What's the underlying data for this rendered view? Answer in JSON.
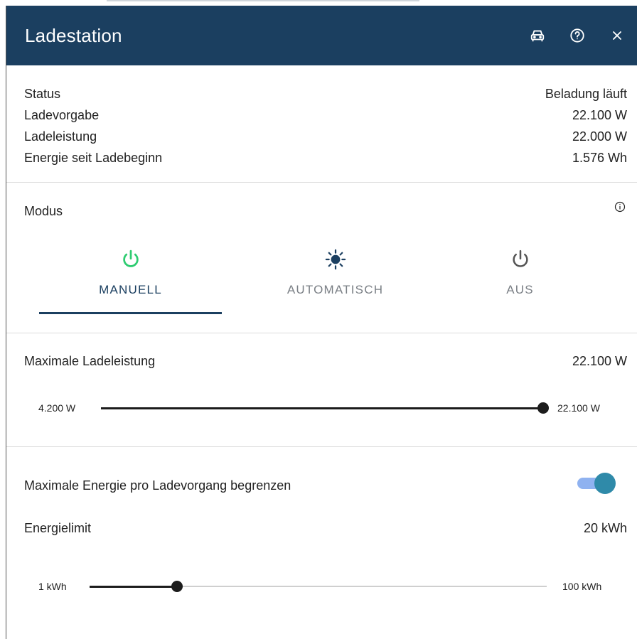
{
  "header": {
    "title": "Ladestation"
  },
  "icons": {
    "car": "car-icon",
    "help": "help-circle-icon",
    "close": "close-icon",
    "info": "info-icon"
  },
  "status": [
    {
      "label": "Status",
      "value": "Beladung läuft"
    },
    {
      "label": "Ladevorgabe",
      "value": "22.100 W"
    },
    {
      "label": "Ladeleistung",
      "value": "22.000 W"
    },
    {
      "label": "Energie seit Ladebeginn",
      "value": "1.576 Wh"
    }
  ],
  "modus": {
    "label": "Modus",
    "tabs": [
      {
        "label": "MANUELL",
        "icon": "power-icon",
        "active": true
      },
      {
        "label": "AUTOMATISCH",
        "icon": "sun-icon",
        "active": false
      },
      {
        "label": "AUS",
        "icon": "power-icon",
        "active": false
      }
    ]
  },
  "max_ladeleistung": {
    "label": "Maximale Ladeleistung",
    "value": "22.100 W",
    "slider": {
      "min_label": "4.200 W",
      "max_label": "22.100 W",
      "fraction": 1.0
    }
  },
  "energy_limit": {
    "toggle_label": "Maximale Energie pro Ladevorgang begrenzen",
    "toggle_on": true,
    "label": "Energielimit",
    "value": "20 kWh",
    "slider": {
      "min_label": "1 kWh",
      "max_label": "100 kWh",
      "fraction": 0.192
    }
  },
  "colors": {
    "header_bg": "#1b3f60",
    "active_tab": "#1b3f60",
    "power_green": "#2ecc71",
    "toggle_knob": "#2f8aa9",
    "toggle_track": "#8fb2f0"
  }
}
